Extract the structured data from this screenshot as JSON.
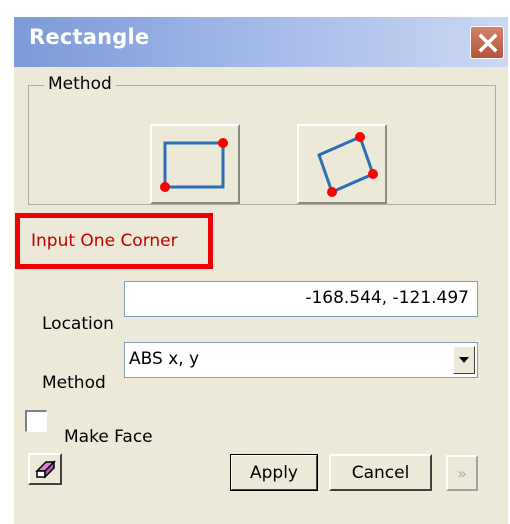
{
  "window": {
    "title": "Rectangle",
    "close_icon": "close-x-icon"
  },
  "method_group": {
    "label": "Method",
    "options": [
      {
        "name": "axis-aligned-rectangle",
        "icon": "rectangle-two-corners-icon"
      },
      {
        "name": "rotated-rectangle",
        "icon": "rectangle-three-corners-icon"
      }
    ]
  },
  "status": {
    "prompt": "Input One Corner",
    "color": "#c00000",
    "box_color": "#f00000"
  },
  "location": {
    "label": "Location",
    "value": "-168.544, -121.497"
  },
  "method_select": {
    "label": "Method",
    "value": "ABS x, y"
  },
  "make_face": {
    "label": "Make Face",
    "checked": false
  },
  "buttons": {
    "apply": "Apply",
    "cancel": "Cancel",
    "more": "»"
  },
  "colors": {
    "title_gradient_start": "#7b9ad8",
    "dialog_bg": "#ece9d8",
    "icon_line": "#2d6fb4",
    "corner_dot": "#ff0000"
  }
}
